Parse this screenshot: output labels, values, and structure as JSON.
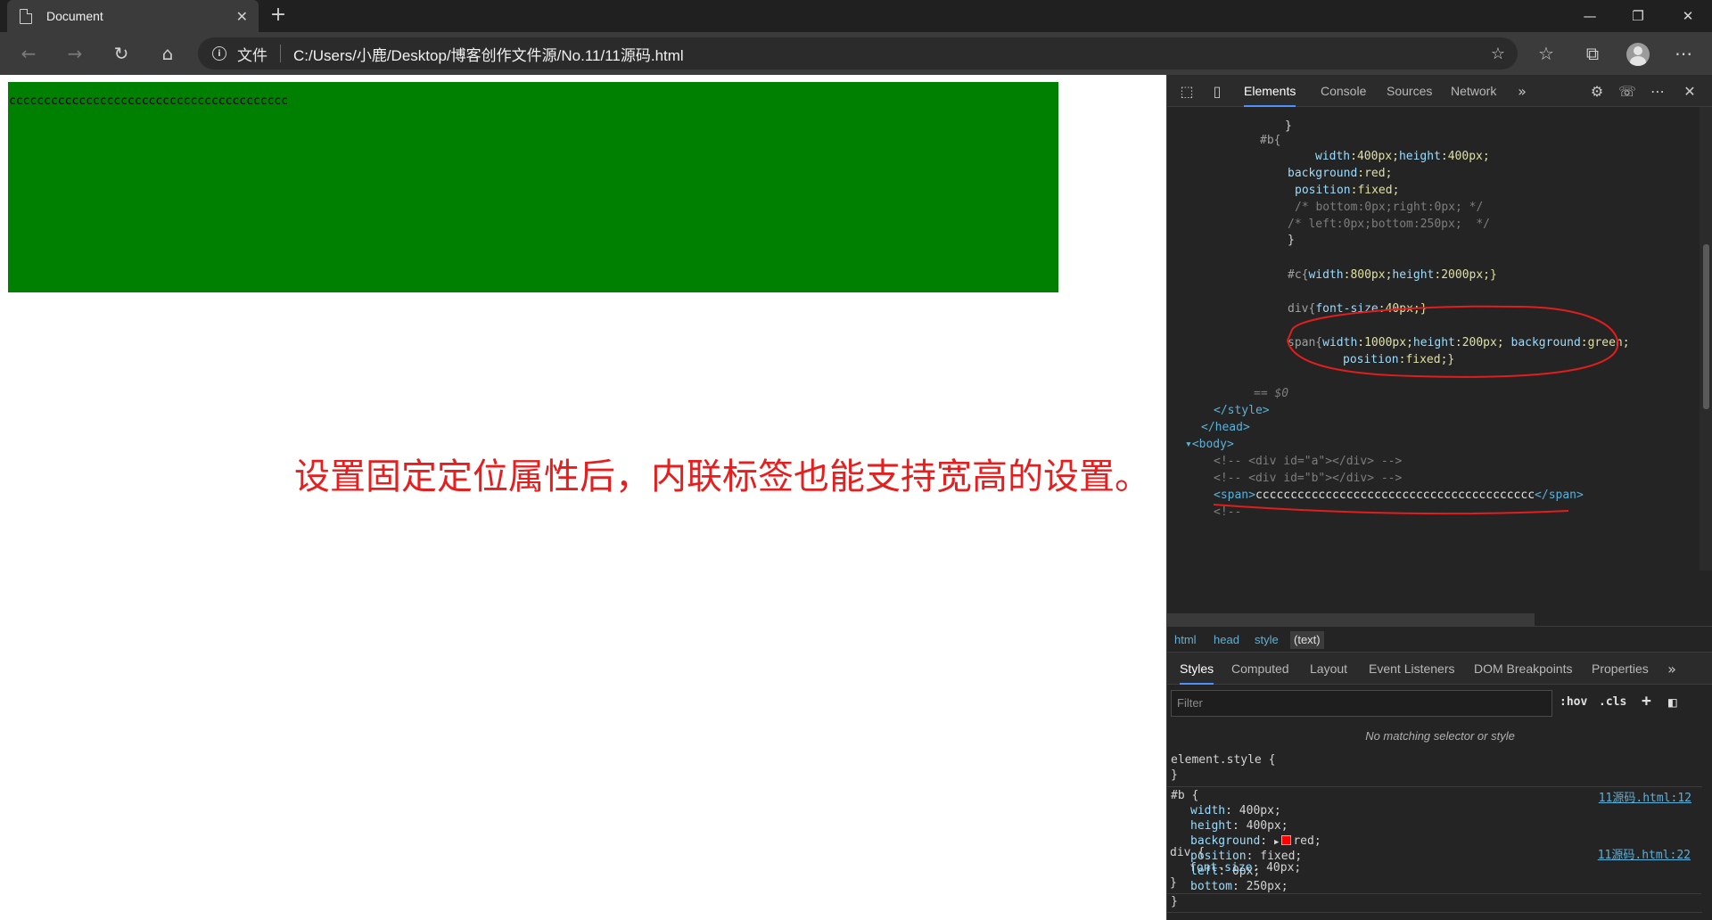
{
  "browser": {
    "tab_title": "Document",
    "tab_close": "✕",
    "new_tab": "+",
    "win_min": "—",
    "win_restore": "❐",
    "win_close": "✕",
    "address_label": "文件",
    "url": "C:/Users/小鹿/Desktop/博客创作文件源/No.11/11源码.html"
  },
  "page": {
    "span_text": "cccccccccccccccccccccccccccccccccccccccc",
    "span_background": "#008000",
    "annotation": "设置固定定位属性后，内联标签也能支持宽高的设置。",
    "annotation_color": "#e61e1e"
  },
  "devtools": {
    "tabs": [
      "Elements",
      "Console",
      "Sources",
      "Network"
    ],
    "code": {
      "l1": "}",
      "l2": "#b{",
      "l3a": "width",
      "l3b": ":400px;",
      "l3c": "height",
      "l3d": ":400px;",
      "l4a": "background",
      "l4b": ":red;",
      "l5a": "position",
      "l5b": ":fixed;",
      "l6": "/* bottom:0px;right:0px; */",
      "l7": "/* left:0px;bottom:250px;  */",
      "l8": "}",
      "l9a": "#c{",
      "l9b": "width",
      "l9c": ":800px;",
      "l9d": "height",
      "l9e": ":2000px;}",
      "l10a": "div{",
      "l10b": "font-size",
      "l10c": ":40px;}",
      "l11a": "span{",
      "l11b": "width",
      "l11c": ":1000px;",
      "l11d": "height",
      "l11e": ":200px; ",
      "l11f": "background",
      "l11g": ":green;",
      "l12a": "position",
      "l12b": ":fixed;}",
      "l13": "== $0",
      "l14": "</style>",
      "l15": "</head>",
      "l16": "<body>",
      "l17": "<!-- <div id=\"a\"></div> -->",
      "l18": "<!-- <div id=\"b\"></div> -->",
      "l19a": "<span>",
      "l19b": "cccccccccccccccccccccccccccccccccccccccc",
      "l19c": "</span>",
      "l20": "<!--"
    },
    "breadcrumbs": [
      "html",
      "head",
      "style",
      "(text)"
    ],
    "sub_tabs": [
      "Styles",
      "Computed",
      "Layout",
      "Event Listeners",
      "DOM Breakpoints",
      "Properties"
    ],
    "filter_placeholder": "Filter",
    "hov": ":hov",
    "cls": ".cls",
    "plus": "+",
    "no_match": "No matching selector or style",
    "element_style": "element.style {",
    "close_brace": "}",
    "rule_b": {
      "selector": "#b {",
      "source": "11源码.html:12",
      "props": [
        {
          "name": "width",
          "value": "400px;"
        },
        {
          "name": "height",
          "value": "400px;"
        },
        {
          "name": "background",
          "value": "red;"
        },
        {
          "name": "position",
          "value": "fixed;"
        },
        {
          "name": "left",
          "value": "0px;"
        },
        {
          "name": "bottom",
          "value": "250px;"
        }
      ]
    },
    "rule_div": {
      "selector": "div {",
      "source": "11源码.html:22",
      "props": [
        {
          "name": "font-size",
          "value": "40px;"
        }
      ]
    }
  }
}
